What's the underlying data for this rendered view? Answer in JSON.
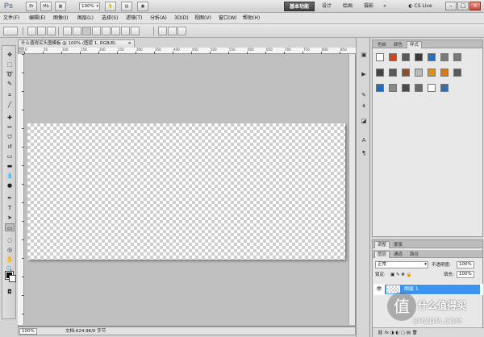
{
  "titlebar": {
    "app_logo": "Ps",
    "zoom_select": "100%",
    "workspaces": {
      "active": "基本功能",
      "design": "设计",
      "painting": "绘画",
      "photography": "摄影"
    },
    "cs_live": "CS Live",
    "window_buttons": {
      "minimize": "–",
      "maximize": "□",
      "close": "×"
    }
  },
  "menu": {
    "items": [
      "文件(F)",
      "编辑(E)",
      "图像(I)",
      "图层(L)",
      "选择(S)",
      "滤镜(T)",
      "分析(A)",
      "3D(D)",
      "视图(V)",
      "窗口(W)",
      "帮助(H)"
    ]
  },
  "document": {
    "tab_title": "什么值得买头图模板 @ 100% (图层 1, RGB/8)",
    "tab_close": "×",
    "zoom": "100%",
    "info": "文档:624.9K/0 字节",
    "ruler_labels": [
      "0",
      "50",
      "100",
      "150",
      "200",
      "250",
      "300",
      "350",
      "400",
      "450",
      "500",
      "550",
      "600",
      "650",
      "700",
      "750",
      "800",
      "850"
    ]
  },
  "styles_panel": {
    "tabs": [
      "色板",
      "颜色",
      "样式"
    ],
    "active_tab": "样式",
    "swatch_colors": [
      "#ffffff",
      "#c84a1e",
      "#5a5a5a",
      "#3a3a3a",
      "#2a6eb8",
      "#7a7a7a",
      "#7a7a7a",
      "#444444",
      "#5a5a5a",
      "#8a5030",
      "#b8b8b8",
      "#d89020",
      "#d47a18",
      "#5a5a5a",
      "#1c6ec0",
      "#8a8a8a",
      "#4a4a4a",
      "#6a6a6a",
      "#ffffff",
      "#3a6ea8"
    ]
  },
  "layers_panel": {
    "tabs": [
      "图层",
      "通道",
      "路径"
    ],
    "blend_mode": "正常",
    "opacity_label": "不透明度:",
    "opacity_value": "100%",
    "lock_label": "锁定:",
    "fill_label": "填充:",
    "fill_value": "100%",
    "layer_name": "图层 1"
  },
  "panel_extra": {
    "tabs": [
      "调整",
      "蒙版"
    ]
  },
  "watermark": {
    "mark": "值",
    "text": "什么值得买",
    "url": "SMZDM.COM"
  }
}
